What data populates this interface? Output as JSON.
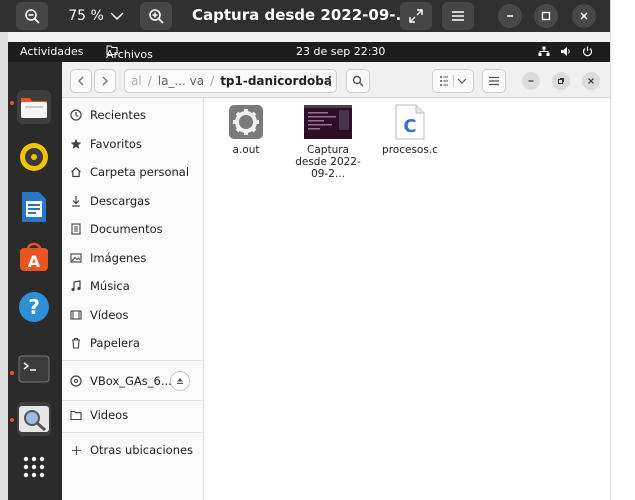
{
  "viewer": {
    "zoom": "75 %",
    "title": "Captura desde 2022-09-..."
  },
  "topbar": {
    "activities": "Actividades",
    "app_menu": "Archivos",
    "clock": "23 de sep  22:30"
  },
  "files": {
    "path": {
      "seg1": "al",
      "seg2": "la_... va",
      "current": "tp1-danicordoba"
    },
    "sidebar": {
      "items": [
        {
          "label": "Recientes"
        },
        {
          "label": "Favoritos"
        },
        {
          "label": "Carpeta personal"
        },
        {
          "label": "Descargas"
        },
        {
          "label": "Documentos"
        },
        {
          "label": "Imágenes"
        },
        {
          "label": "Música"
        },
        {
          "label": "Vídeos"
        },
        {
          "label": "Papelera"
        }
      ],
      "device": {
        "label": "VBox_GAs_6...."
      },
      "bookmark": {
        "label": "Videos"
      },
      "other": {
        "label": "Otras ubicaciones"
      }
    },
    "items": [
      {
        "name": "a.out"
      },
      {
        "name": "Captura desde 2022-09-2..."
      },
      {
        "name": "procesos.c"
      }
    ]
  },
  "colors": {
    "accent": "#e95420",
    "dock": "#2b2b2b",
    "viewer_header": "#303030"
  }
}
